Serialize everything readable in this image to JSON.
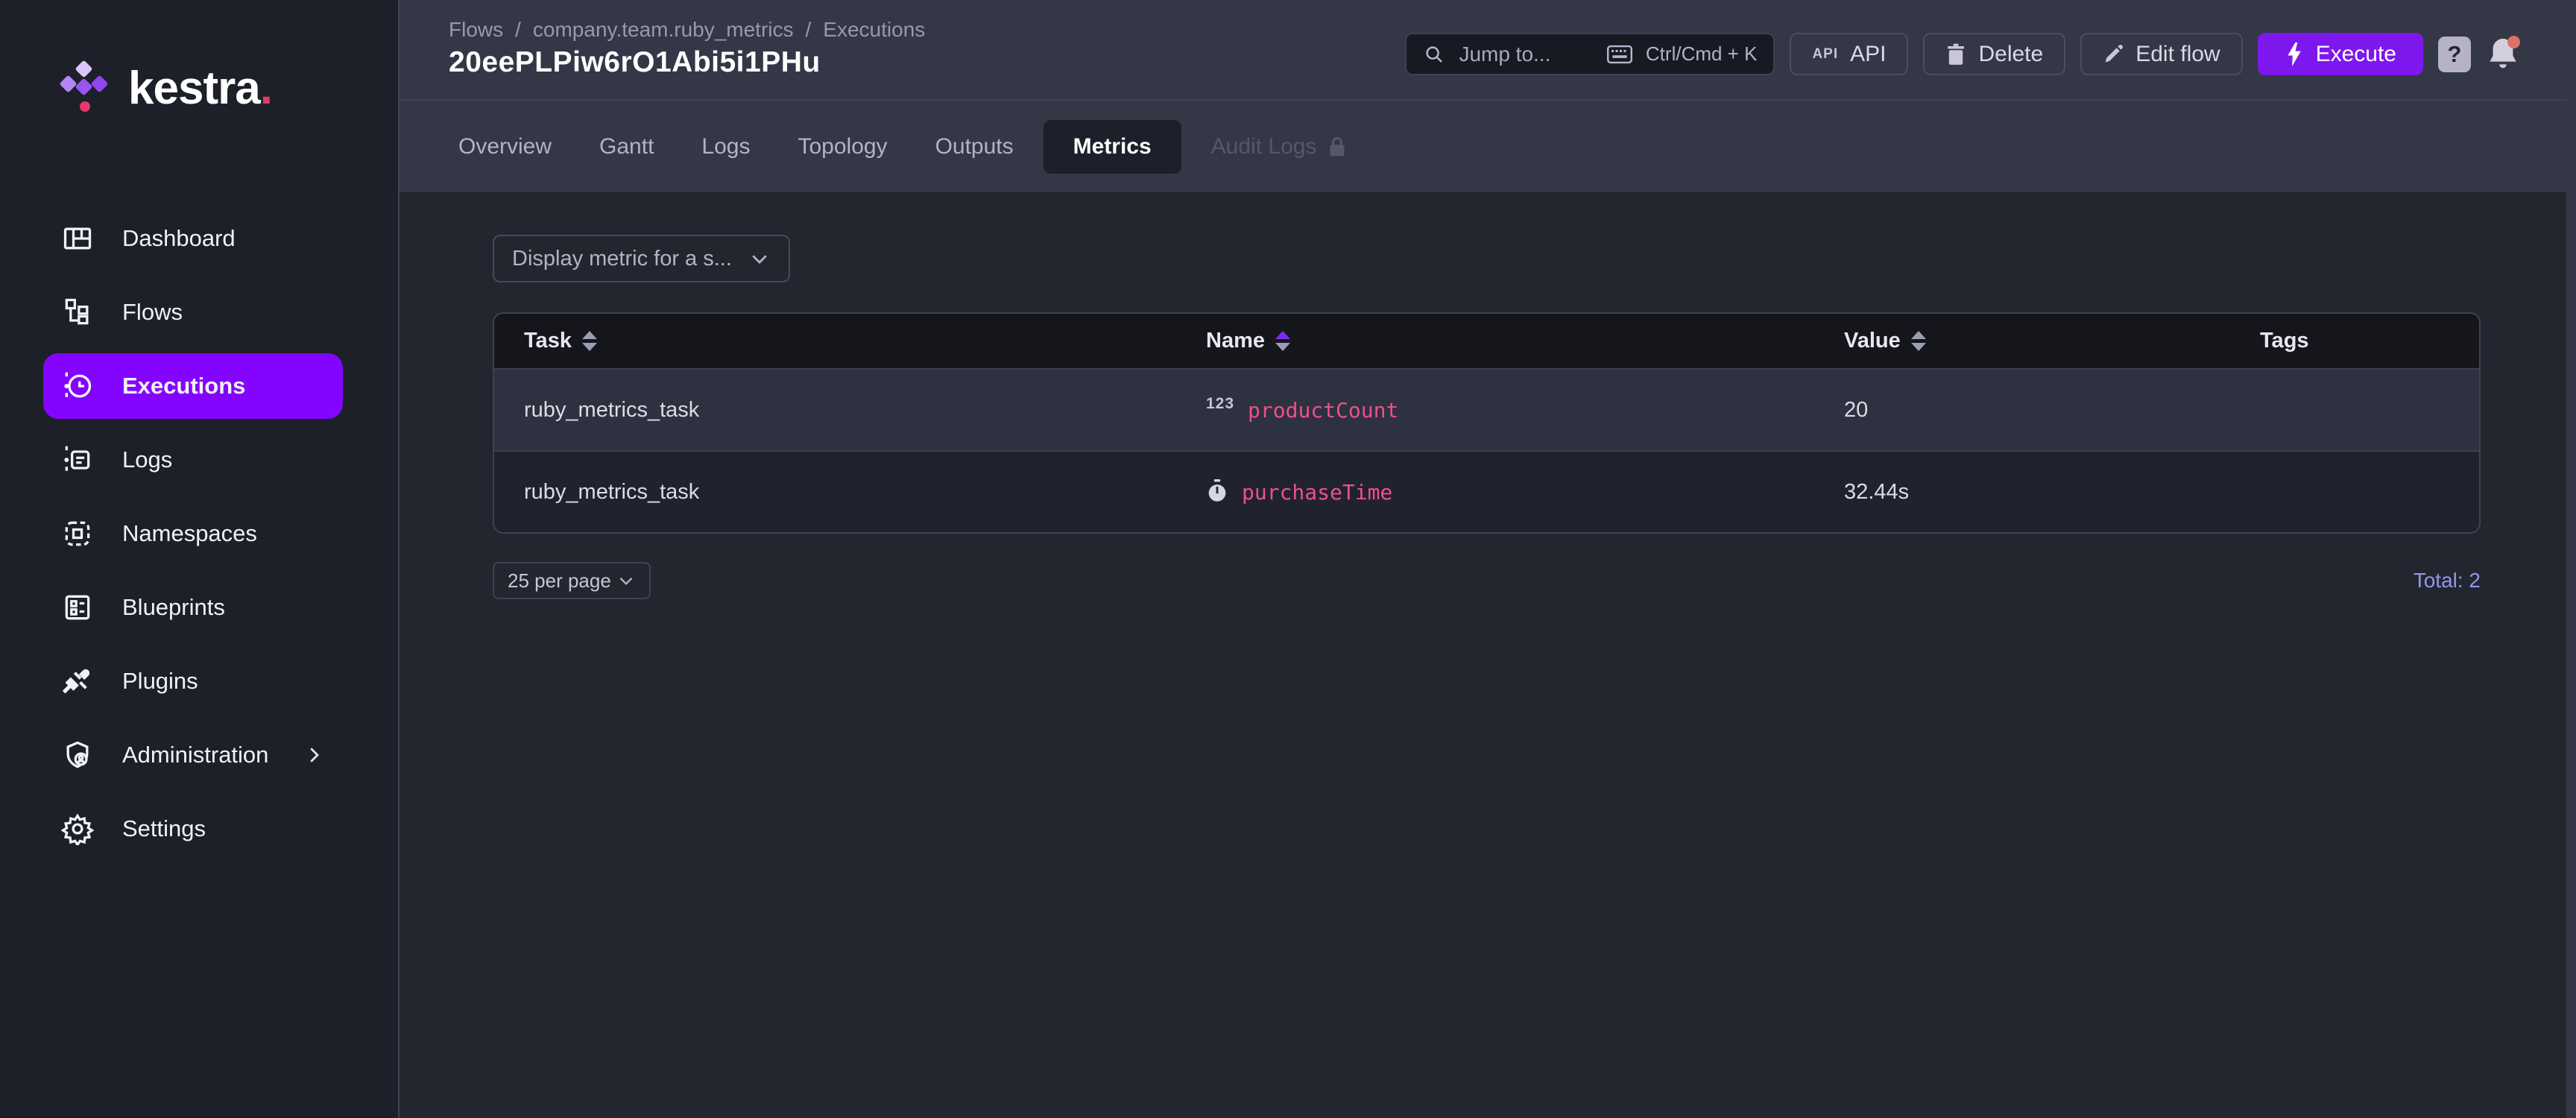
{
  "brand": {
    "name": "kestra",
    "dot": "."
  },
  "breadcrumb": {
    "separator": "/",
    "items": [
      "Flows",
      "company.team.ruby_metrics",
      "Executions"
    ]
  },
  "page": {
    "title": "20eePLPiw6rO1Abi5i1PHu"
  },
  "topbar": {
    "jump_to": {
      "placeholder": "Jump to...",
      "shortcut": "Ctrl/Cmd + K"
    },
    "buttons": {
      "api_icon_label": "API",
      "api": "API",
      "delete": "Delete",
      "edit_flow": "Edit flow",
      "execute": "Execute"
    },
    "help": "?"
  },
  "sidebar": {
    "items": [
      {
        "label": "Dashboard",
        "icon": "dashboard-icon",
        "active": false
      },
      {
        "label": "Flows",
        "icon": "flows-icon",
        "active": false
      },
      {
        "label": "Executions",
        "icon": "executions-icon",
        "active": true
      },
      {
        "label": "Logs",
        "icon": "logs-icon",
        "active": false
      },
      {
        "label": "Namespaces",
        "icon": "namespaces-icon",
        "active": false
      },
      {
        "label": "Blueprints",
        "icon": "blueprints-icon",
        "active": false
      },
      {
        "label": "Plugins",
        "icon": "plugins-icon",
        "active": false
      },
      {
        "label": "Administration",
        "icon": "administration-icon",
        "active": false,
        "has_submenu": true
      },
      {
        "label": "Settings",
        "icon": "settings-icon",
        "active": false
      }
    ]
  },
  "tabs": [
    {
      "label": "Overview",
      "state": "normal"
    },
    {
      "label": "Gantt",
      "state": "normal"
    },
    {
      "label": "Logs",
      "state": "normal"
    },
    {
      "label": "Topology",
      "state": "normal"
    },
    {
      "label": "Outputs",
      "state": "normal"
    },
    {
      "label": "Metrics",
      "state": "active"
    },
    {
      "label": "Audit Logs",
      "state": "disabled",
      "icon": "lock-icon"
    }
  ],
  "toolbar": {
    "metric_select_placeholder": "Display metric for a s..."
  },
  "table": {
    "columns": [
      {
        "label": "Task",
        "sortable": true,
        "sort": "none"
      },
      {
        "label": "Name",
        "sortable": true,
        "sort": "asc"
      },
      {
        "label": "Value",
        "sortable": true,
        "sort": "none"
      },
      {
        "label": "Tags",
        "sortable": false
      }
    ],
    "rows": [
      {
        "task": "ruby_metrics_task",
        "name": "productCount",
        "name_icon": "numeric-metric-icon",
        "name_icon_glyph": "123",
        "value": "20",
        "tags": ""
      },
      {
        "task": "ruby_metrics_task",
        "name": "purchaseTime",
        "name_icon": "timer-metric-icon",
        "value": "32.44s",
        "tags": ""
      }
    ]
  },
  "pagination": {
    "per_page": "25 per page",
    "total_label": "Total: 2"
  },
  "colors": {
    "accent_purple": "#8405ff",
    "execute_purple": "#7e17ee",
    "metric_pink": "#ed4f8f",
    "total_lavender": "#9396ee",
    "alert_dot": "#dd7165",
    "header_band": "#333746",
    "content_bg": "#23262f",
    "sidebar_bg": "#1d2028",
    "table_header_bg": "#14161c"
  }
}
